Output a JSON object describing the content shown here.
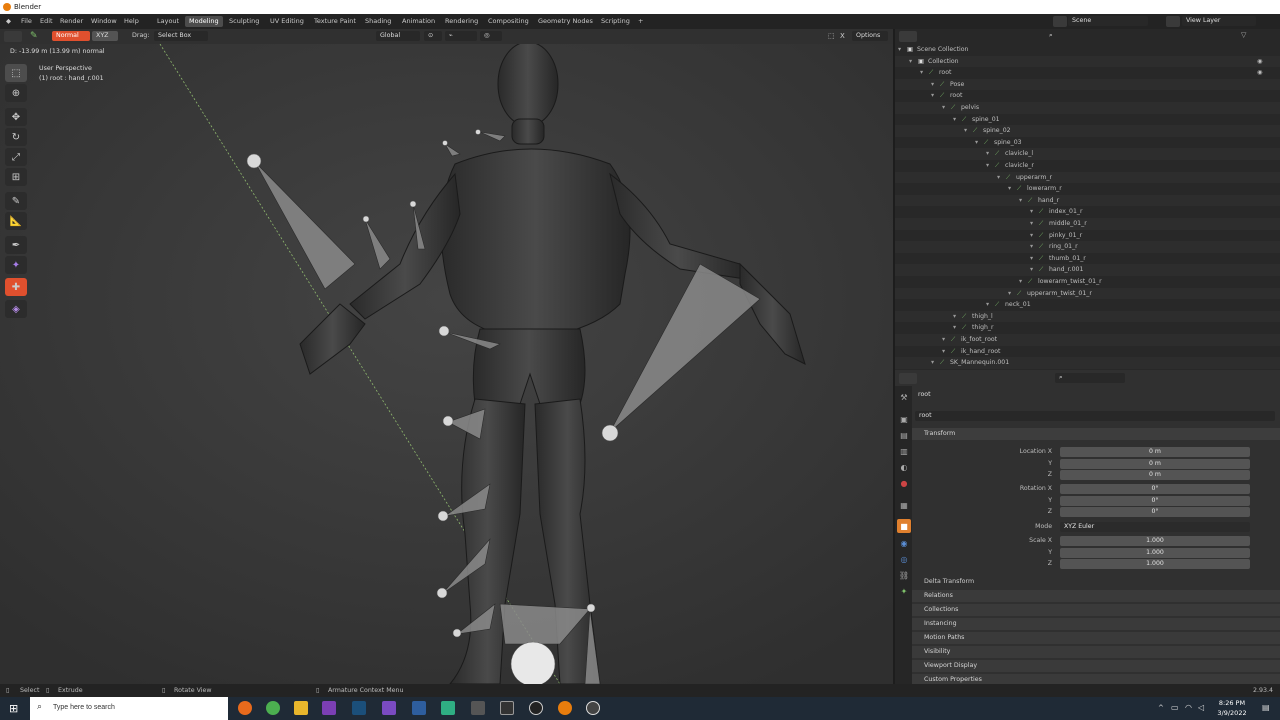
{
  "window": {
    "title": "Blender"
  },
  "menu": [
    "File",
    "Edit",
    "Render",
    "Window",
    "Help"
  ],
  "workspaces": [
    "Layout",
    "Modeling",
    "Sculpting",
    "UV Editing",
    "Texture Paint",
    "Shading",
    "Animation",
    "Rendering",
    "Compositing",
    "Geometry Nodes",
    "Scripting"
  ],
  "active_workspace": "Modeling",
  "scene": "Scene",
  "view_layer": "View Layer",
  "viewport_header": {
    "normal_label": "Normal",
    "xyz_label": "XYZ",
    "drag_label": "Drag:",
    "select_box": "Select Box",
    "orientation": "Global",
    "options": "Options"
  },
  "viewport": {
    "overlay_info": "D: -13.99 m (13.99 m) normal",
    "view_name": "User Perspective",
    "object_info": "(1) root : hand_r.001"
  },
  "outliner": {
    "search_placeholder": "",
    "rows": [
      {
        "label": "Scene Collection",
        "indent": 0
      },
      {
        "label": "Collection",
        "indent": 1
      },
      {
        "label": "root",
        "indent": 2
      },
      {
        "label": "Pose",
        "indent": 3
      },
      {
        "label": "root",
        "indent": 3
      },
      {
        "label": "pelvis",
        "indent": 4
      },
      {
        "label": "spine_01",
        "indent": 5
      },
      {
        "label": "spine_02",
        "indent": 6
      },
      {
        "label": "spine_03",
        "indent": 7
      },
      {
        "label": "clavicle_l",
        "indent": 8
      },
      {
        "label": "clavicle_r",
        "indent": 8
      },
      {
        "label": "upperarm_r",
        "indent": 9
      },
      {
        "label": "lowerarm_r",
        "indent": 10
      },
      {
        "label": "hand_r",
        "indent": 11
      },
      {
        "label": "index_01_r",
        "indent": 12
      },
      {
        "label": "middle_01_r",
        "indent": 12
      },
      {
        "label": "pinky_01_r",
        "indent": 12
      },
      {
        "label": "ring_01_r",
        "indent": 12
      },
      {
        "label": "thumb_01_r",
        "indent": 12
      },
      {
        "label": "hand_r.001",
        "indent": 12
      },
      {
        "label": "lowerarm_twist_01_r",
        "indent": 11
      },
      {
        "label": "upperarm_twist_01_r",
        "indent": 10
      },
      {
        "label": "neck_01",
        "indent": 8
      },
      {
        "label": "thigh_l",
        "indent": 5
      },
      {
        "label": "thigh_r",
        "indent": 5
      },
      {
        "label": "ik_foot_root",
        "indent": 4
      },
      {
        "label": "ik_hand_root",
        "indent": 4
      },
      {
        "label": "SK_Mannequin.001",
        "indent": 3
      }
    ]
  },
  "properties": {
    "object_name": "root",
    "bone_name": "root",
    "transform_header": "Transform",
    "location_label": "Location X",
    "rotation_label": "Rotation X",
    "scale_label": "Scale X",
    "y_label": "Y",
    "z_label": "Z",
    "location": [
      "0 m",
      "0 m",
      "0 m"
    ],
    "rotation": [
      "0°",
      "0°",
      "0°"
    ],
    "mode_label": "Mode",
    "mode": "XYZ Euler",
    "scale": [
      "1.000",
      "1.000",
      "1.000"
    ],
    "delta": "Delta Transform",
    "panels": [
      "Relations",
      "Collections",
      "Instancing",
      "Motion Paths",
      "Visibility",
      "Viewport Display",
      "Custom Properties"
    ]
  },
  "statusbar": {
    "select": "Select",
    "extrude": "Extrude",
    "rotate": "Rotate View",
    "context": "Armature Context Menu",
    "version": "2.93.4"
  },
  "taskbar": {
    "search_placeholder": "Type here to search",
    "time": "8:26 PM",
    "date": "3/9/2022"
  },
  "colors": {
    "accent": "#e0502e",
    "viewport_bg": "#3c3c3c",
    "bone_green": "#7fc26b"
  }
}
